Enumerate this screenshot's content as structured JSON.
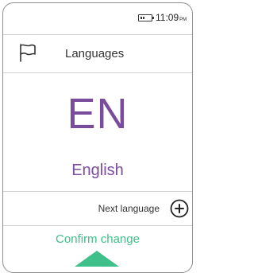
{
  "status_bar": {
    "battery_icon": "battery-icon",
    "time": "11:09",
    "ampm": "PM"
  },
  "header": {
    "icon": "flag-icon",
    "title": "Languages"
  },
  "language": {
    "code": "EN",
    "name": "English"
  },
  "next": {
    "label": "Next language",
    "icon": "plus-circle-icon"
  },
  "confirm": {
    "label": "Confirm change",
    "icon": "up-arrow-icon"
  },
  "colors": {
    "language_text": "#7a4c9c",
    "confirm_text": "#3fbf8a"
  }
}
